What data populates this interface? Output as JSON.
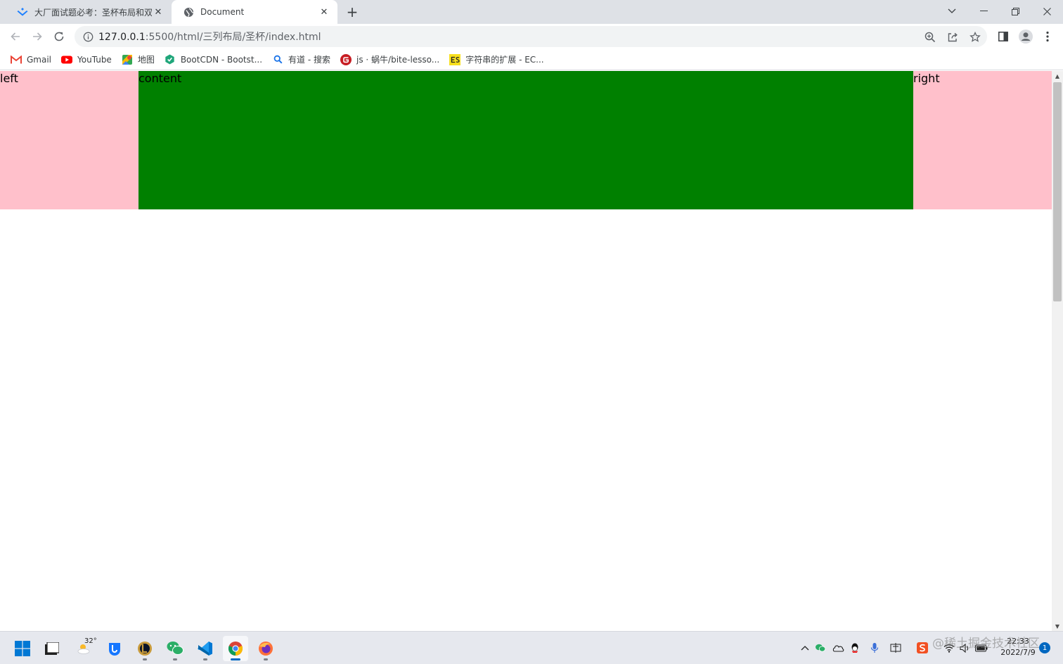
{
  "browser": {
    "tabs": [
      {
        "title": "大厂面试题必考：圣杯布局和双飞翼",
        "icon": "juejin-icon",
        "active": false
      },
      {
        "title": "Document",
        "icon": "globe-icon",
        "active": true
      }
    ],
    "address": {
      "host": "127.0.0.1",
      "path": ":5500/html/三列布局/圣杯/index.html"
    },
    "bookmarks": [
      {
        "label": "Gmail",
        "icon": "gmail-icon"
      },
      {
        "label": "YouTube",
        "icon": "youtube-icon"
      },
      {
        "label": "地图",
        "icon": "maps-icon"
      },
      {
        "label": "BootCDN - Bootst...",
        "icon": "bootcdn-icon"
      },
      {
        "label": "有道 - 搜索",
        "icon": "search-icon"
      },
      {
        "label": "js · 蜗牛/bite-lesso...",
        "icon": "gitee-icon"
      },
      {
        "label": "字符串的扩展 - EC...",
        "icon": "es-icon"
      }
    ]
  },
  "page": {
    "left": "left",
    "content": "content",
    "right": "right",
    "colors": {
      "side": "#ffc0cb",
      "main": "#008000"
    }
  },
  "taskbar": {
    "weather_temp": "32°",
    "time": "22:33",
    "date": "2022/7/9",
    "notifications": "1",
    "watermark": "@稀土掘金技术社区"
  }
}
